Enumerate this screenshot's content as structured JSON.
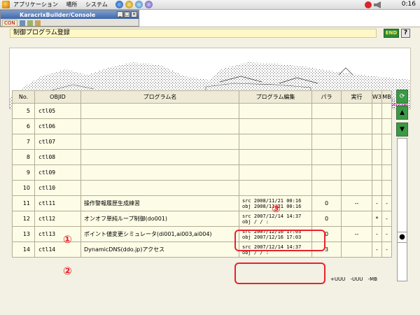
{
  "top_panel": {
    "menu": [
      "アプリケーション",
      "場所",
      "システム"
    ],
    "clock": "0:16"
  },
  "console": {
    "title": "KaracrixBuilder/Console",
    "tag": "CON"
  },
  "header": {
    "title": "制御プログラム登録",
    "end_label": "END",
    "help_label": "?"
  },
  "banner": {
    "credit": "Kanbara Yorunyuki(syohan)/Hiroshige"
  },
  "table": {
    "columns": [
      "No.",
      "OBJID",
      "プログラム名",
      "プログラム編集",
      "パラ",
      "実行",
      "W3",
      "MB"
    ],
    "rows": [
      {
        "no": "5",
        "objid": "ctl05",
        "name": "",
        "src": "",
        "obj": "",
        "para": "",
        "exec": "",
        "w3": "",
        "mb": ""
      },
      {
        "no": "6",
        "objid": "ctl06",
        "name": "",
        "src": "",
        "obj": "",
        "para": "",
        "exec": "",
        "w3": "",
        "mb": ""
      },
      {
        "no": "7",
        "objid": "ctl07",
        "name": "",
        "src": "",
        "obj": "",
        "para": "",
        "exec": "",
        "w3": "",
        "mb": ""
      },
      {
        "no": "8",
        "objid": "ctl08",
        "name": "",
        "src": "",
        "obj": "",
        "para": "",
        "exec": "",
        "w3": "",
        "mb": ""
      },
      {
        "no": "9",
        "objid": "ctl09",
        "name": "",
        "src": "",
        "obj": "",
        "para": "",
        "exec": "",
        "w3": "",
        "mb": ""
      },
      {
        "no": "10",
        "objid": "ctl10",
        "name": "",
        "src": "",
        "obj": "",
        "para": "",
        "exec": "",
        "w3": "",
        "mb": ""
      },
      {
        "no": "11",
        "objid": "ctl11",
        "name": "操作警報履歴生成練習",
        "src": "src  2008/11/21 00:16",
        "obj": "obj  2008/11/21 00:16",
        "para": "0",
        "exec": "--",
        "w3": "-",
        "mb": "-"
      },
      {
        "no": "12",
        "objid": "ctl12",
        "name": "オンオフ単純ループ制御(do001)",
        "src": "src  2007/12/14 14:37",
        "obj": "obj   /  /     :",
        "para": "0",
        "exec": "",
        "w3": "*",
        "mb": "-"
      },
      {
        "no": "13",
        "objid": "ctl13",
        "name": "ポイント値変更シミュレータ(di001,ai003,ai004)",
        "src": "src  2007/12/16 17:03",
        "obj": "obj  2007/12/16 17:03",
        "para": "0",
        "exec": "--",
        "w3": "-",
        "mb": "-"
      },
      {
        "no": "14",
        "objid": "ctl14",
        "name": "DynamicDNS(ddo.jp)アクセス",
        "src": "src  2007/12/14 14:37",
        "obj": "obj   /  /     :",
        "para": "3",
        "exec": "",
        "w3": "-",
        "mb": "-"
      }
    ]
  },
  "annotations": {
    "marker1": "①",
    "marker2": "②",
    "marker3": "③"
  },
  "side": {
    "refresh_icon": "refresh-icon",
    "up_icon": "up-arrow-icon",
    "down_icon": "down-arrow-icon",
    "thumb_icon": "scroll-thumb-icon"
  },
  "footer": {
    "links": [
      "+UUU",
      "-UUU",
      "-MB"
    ]
  }
}
